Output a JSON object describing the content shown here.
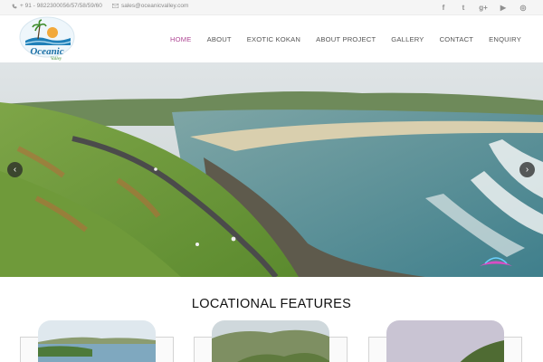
{
  "topbar": {
    "phone": "+ 91 - 9822300056/57/58/59/60",
    "email": "sales@oceanicvalley.com",
    "phone_icon": "phone-icon",
    "email_icon": "envelope-icon",
    "socials": [
      {
        "name": "facebook-icon",
        "glyph": "f"
      },
      {
        "name": "twitter-icon",
        "glyph": "t"
      },
      {
        "name": "google-plus-icon",
        "glyph": "g+"
      },
      {
        "name": "youtube-icon",
        "glyph": "▶"
      },
      {
        "name": "instagram-icon",
        "glyph": "◎"
      }
    ]
  },
  "header": {
    "logo_text": "Oceanic",
    "logo_subtext": "Valley",
    "nav": [
      "HOME",
      "ABOUT",
      "EXOTIC KOKAN",
      "ABOUT PROJECT",
      "GALLERY",
      "CONTACT",
      "ENQUIRY"
    ],
    "active": "HOME"
  },
  "hero": {
    "prev_icon": "chevron-left-icon",
    "next_icon": "chevron-right-icon",
    "prev_glyph": "‹",
    "next_glyph": "›"
  },
  "features": {
    "title": "LOCATIONAL FEATURES"
  },
  "colors": {
    "accent": "#b04a96",
    "nav_text": "#555555",
    "topbar_bg": "#f5f5f5"
  }
}
